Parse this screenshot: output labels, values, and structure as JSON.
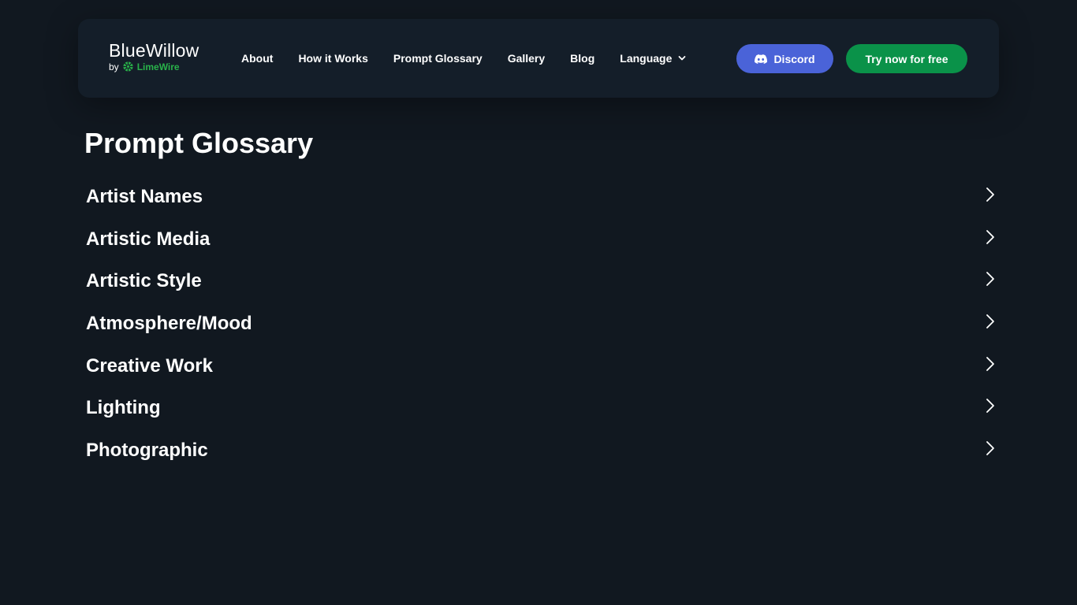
{
  "brand": {
    "name": "BlueWillow",
    "by": "by",
    "partner": "LimeWire",
    "partner_color": "#29b24a"
  },
  "nav": {
    "links": [
      "About",
      "How it Works",
      "Prompt Glossary",
      "Gallery",
      "Blog"
    ],
    "language": "Language"
  },
  "buttons": {
    "discord": "Discord",
    "discord_color": "#4a63d8",
    "try": "Try now for free",
    "try_color": "#0a9249"
  },
  "page": {
    "title": "Prompt Glossary"
  },
  "glossary": {
    "items": [
      "Artist Names",
      "Artistic Media",
      "Artistic Style",
      "Atmosphere/Mood",
      "Creative Work",
      "Lighting",
      "Photographic"
    ]
  },
  "icons": {
    "discord": "discord-icon",
    "language_toggle": "chevron-down-icon",
    "item_arrow": "chevron-right-icon",
    "partner_logo": "limewire-logo-icon"
  }
}
